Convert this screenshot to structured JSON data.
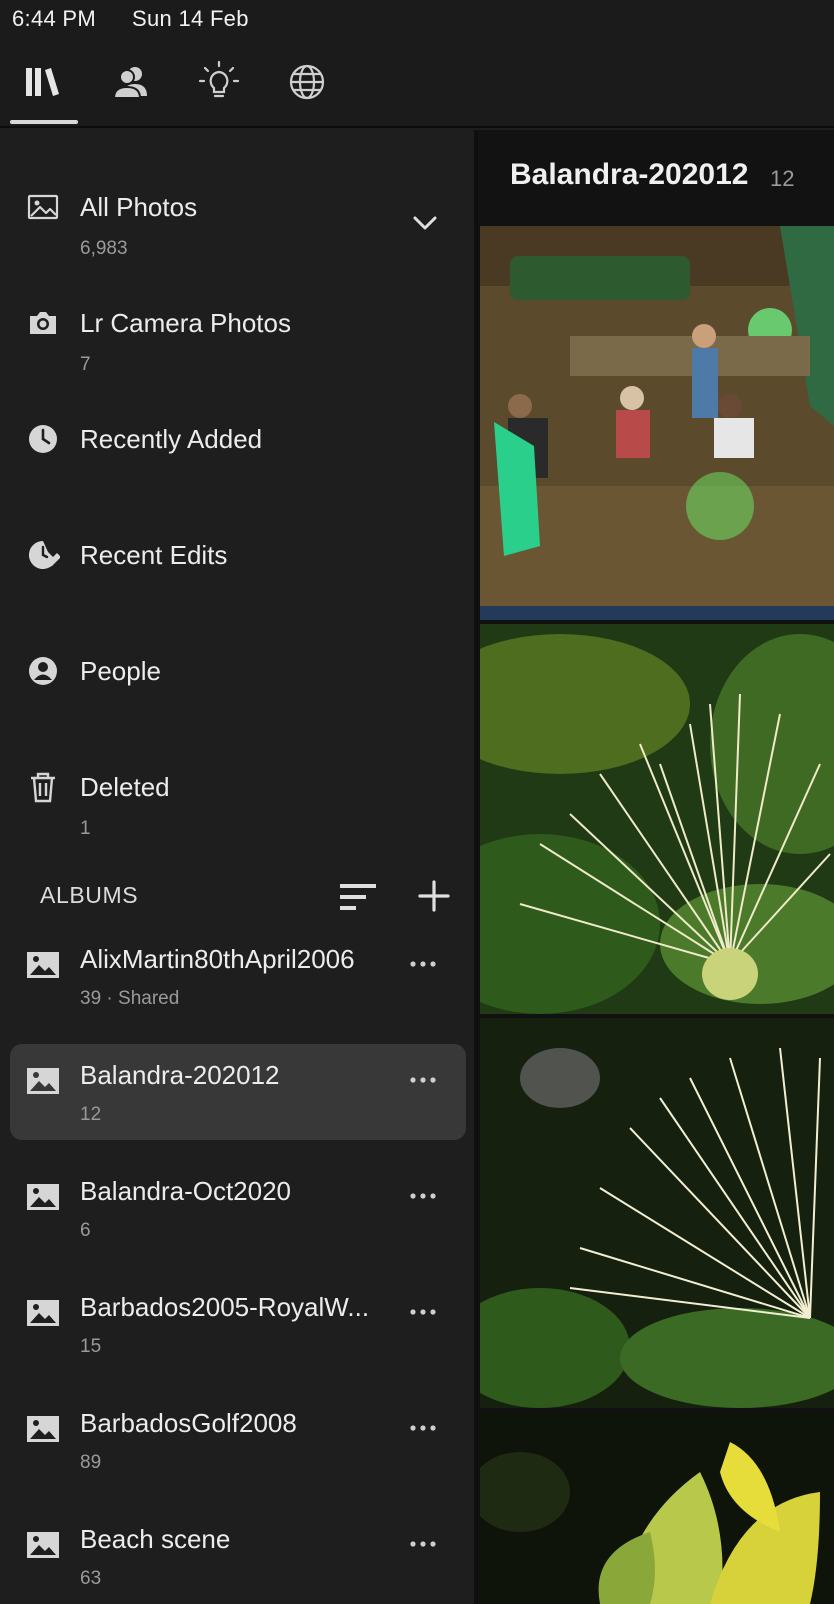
{
  "status_bar": {
    "time": "6:44 PM",
    "date": "Sun 14 Feb"
  },
  "top_nav": {
    "tabs": [
      {
        "icon": "library-icon",
        "active": true
      },
      {
        "icon": "people-icon",
        "active": false
      },
      {
        "icon": "learn-lightbulb-icon",
        "active": false
      },
      {
        "icon": "discover-globe-icon",
        "active": false
      }
    ]
  },
  "sidebar": {
    "items": [
      {
        "label": "All Photos",
        "count": "6,983",
        "icon": "photo-icon"
      },
      {
        "label": "Lr Camera Photos",
        "count": "7",
        "icon": "camera-icon"
      },
      {
        "label": "Recently Added",
        "count": "",
        "icon": "clock-icon"
      },
      {
        "label": "Recent Edits",
        "count": "",
        "icon": "edit-clock-icon"
      },
      {
        "label": "People",
        "count": "",
        "icon": "person-icon"
      },
      {
        "label": "Deleted",
        "count": "1",
        "icon": "trash-icon"
      }
    ],
    "albums_title": "ALBUMS",
    "albums": [
      {
        "label": "AlixMartin80thApril2006",
        "count": "39 · Shared",
        "selected": false
      },
      {
        "label": "Balandra-202012",
        "count": "12",
        "selected": true
      },
      {
        "label": "Balandra-Oct2020",
        "count": "6",
        "selected": false
      },
      {
        "label": "Barbados2005-RoyalW...",
        "count": "15",
        "selected": false
      },
      {
        "label": "BarbadosGolf2008",
        "count": "89",
        "selected": false
      },
      {
        "label": "Beach scene",
        "count": "63",
        "selected": false
      }
    ]
  },
  "pane": {
    "title": "Balandra-202012",
    "count": "12",
    "photos": [
      "patio-night-scene",
      "white-flower-closeup",
      "white-flower-side",
      "yellow-green-leaves"
    ]
  },
  "colors": {
    "background": "#1e1e1e",
    "selected_row": "#383838",
    "text": "#ececec",
    "muted": "#9a9a9a"
  }
}
